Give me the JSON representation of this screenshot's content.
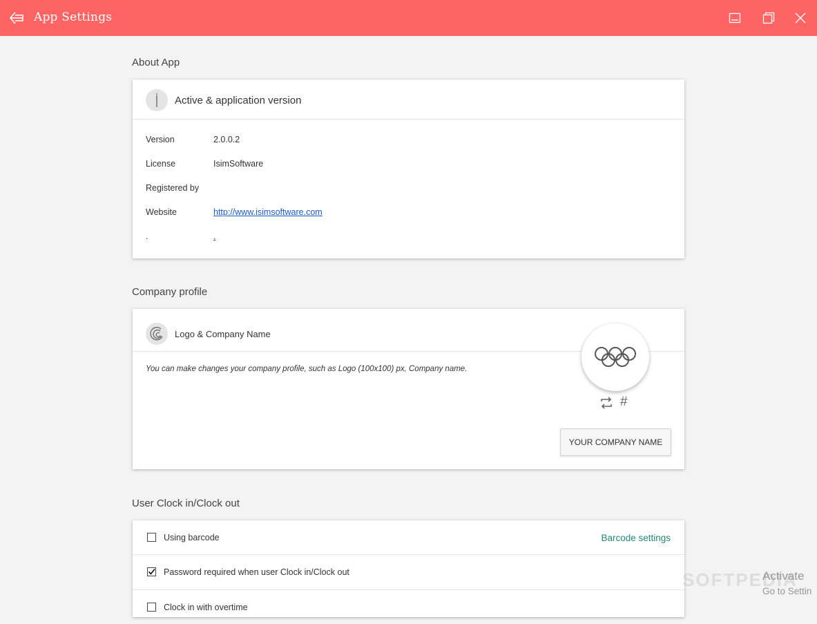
{
  "window": {
    "title": "App Settings",
    "accent_color": "#ff6464"
  },
  "about": {
    "section_title": "About App",
    "header": "Active & application version",
    "icon": "info-icon",
    "rows": [
      {
        "label": "Version",
        "value": "2.0.0.2"
      },
      {
        "label": "License",
        "value": "IsimSoftware"
      },
      {
        "label": "Registered by",
        "value": ""
      },
      {
        "label": "Website",
        "value": "http://www.isimsoftware.com"
      },
      {
        "label": ".",
        "value": "."
      }
    ]
  },
  "company": {
    "section_title": "Company profile",
    "header": "Logo & Company Name",
    "icon": "logo-icon",
    "description": "You can make changes your company profile, such as Logo (100x100) px, Company name.",
    "name_button": "YOUR COMPANY NAME",
    "logo_actions": [
      "swap-icon",
      "hash-icon"
    ]
  },
  "clock": {
    "section_title": "User Clock in/Clock out",
    "options": [
      {
        "label": "Using barcode",
        "checked": false,
        "link": "Barcode settings"
      },
      {
        "label": "Password required when user Clock in/Clock out",
        "checked": true
      },
      {
        "label": "Clock in with overtime",
        "checked": false
      }
    ],
    "link_color": "#1f8a7a"
  },
  "watermark": {
    "brand": "SOFTPEDIA",
    "activate_title": "Activate",
    "activate_sub": "Go to Settin"
  }
}
